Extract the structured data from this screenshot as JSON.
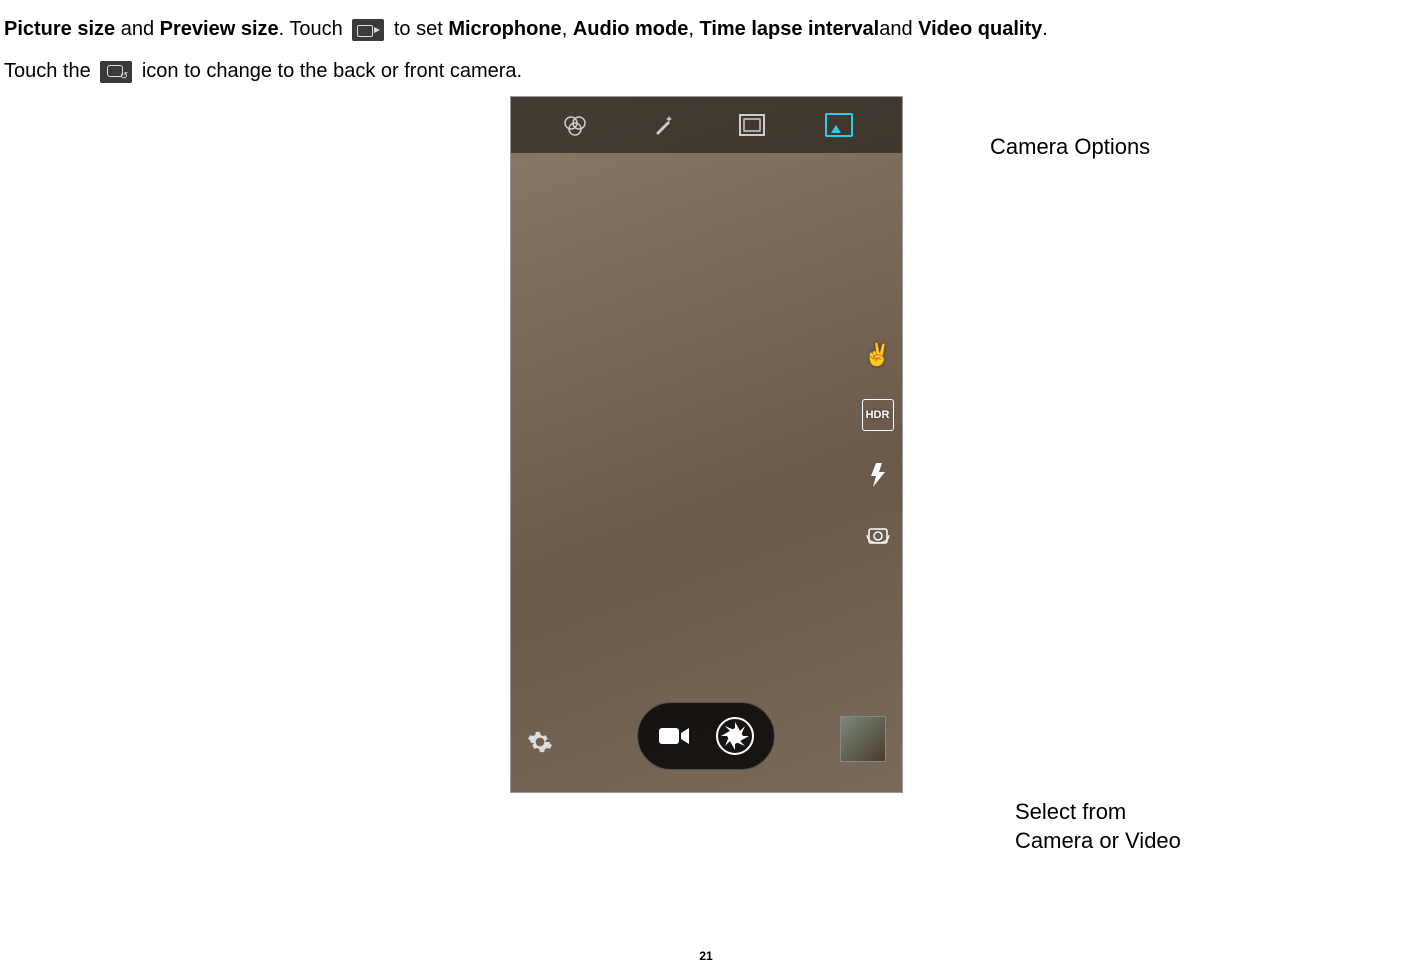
{
  "text": {
    "line1_bold1": "Picture size",
    "line1_mid1": " and ",
    "line1_bold2": "Preview size",
    "line1_mid2": ". Touch ",
    "line1_mid3": " to set ",
    "line1_bold3": "Microphone",
    "line1_comma1": ", ",
    "line1_bold4": "Audio mode",
    "line1_comma2": ", ",
    "line1_bold5": "Time lapse interval",
    "line1_mid4": "and ",
    "line1_bold6": "Video quality",
    "line1_period": ".",
    "line3_pre": "Touch the ",
    "line3_post": " icon to change to the back or front camera."
  },
  "callouts": {
    "top": "Camera Options",
    "bottom_l1": "Select from",
    "bottom_l2": "Camera or Video"
  },
  "page_number": "21",
  "icons": {
    "video_settings": "video-settings-icon",
    "switch_camera": "switch-camera-icon",
    "filter": "filter-icon",
    "magic": "magic-wand-icon",
    "frame": "frame-icon",
    "media": "gallery-icon",
    "gesture": "gesture-icon",
    "hdr": "hdr-icon",
    "flash": "flash-icon",
    "rotate_camera": "rotate-camera-icon",
    "video_record": "video-record-icon",
    "shutter": "shutter-icon",
    "settings": "settings-gear-icon",
    "thumb": "thumbnail-preview"
  }
}
